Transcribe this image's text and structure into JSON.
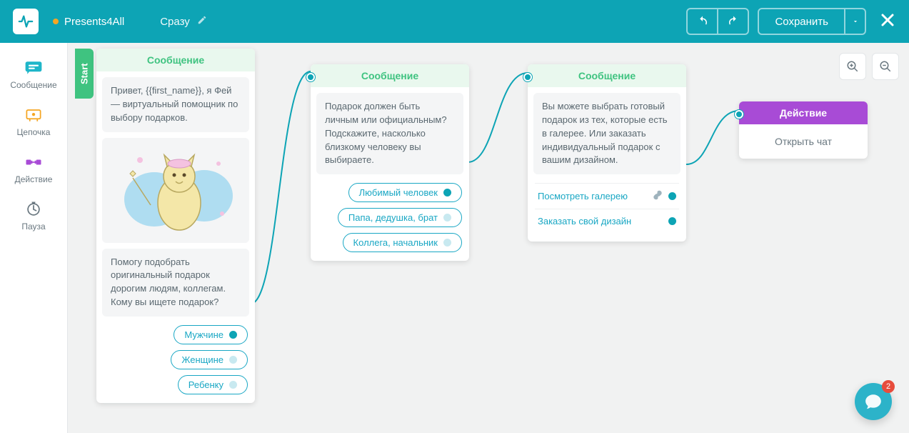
{
  "header": {
    "project_name": "Presents4All",
    "flow_name": "Сразу",
    "save_label": "Сохранить"
  },
  "sidebar": {
    "items": [
      {
        "label": "Сообщение"
      },
      {
        "label": "Цепочка"
      },
      {
        "label": "Действие"
      },
      {
        "label": "Пауза"
      }
    ]
  },
  "canvas": {
    "start_label": "Start",
    "card1": {
      "title": "Сообщение",
      "text1": "Привет,  {{first_name}}, я Фей — виртуальный помощник по выбору подарков.",
      "text2": "Помогу подобрать оригинальный подарок дорогим людям, коллегам. Кому вы ищете подарок?",
      "options": [
        "Мужчине",
        "Женщине",
        "Ребенку"
      ]
    },
    "card2": {
      "title": "Сообщение",
      "text": "Подарок должен быть личным или официальным? Подскажите, насколько близкому человеку вы выбираете.",
      "options": [
        "Любимый человек",
        "Папа, дедушка, брат",
        "Коллега, начальник"
      ]
    },
    "card3": {
      "title": "Сообщение",
      "text": "Вы можете выбрать готовый подарок из тех, которые есть в галерее. Или заказать индивидуальный подарок с вашим дизайном.",
      "options": [
        "Посмотреть галерею",
        "Заказать свой дизайн"
      ]
    },
    "card4": {
      "title": "Действие",
      "body": "Открыть чат"
    }
  },
  "chat": {
    "badge": "2"
  }
}
